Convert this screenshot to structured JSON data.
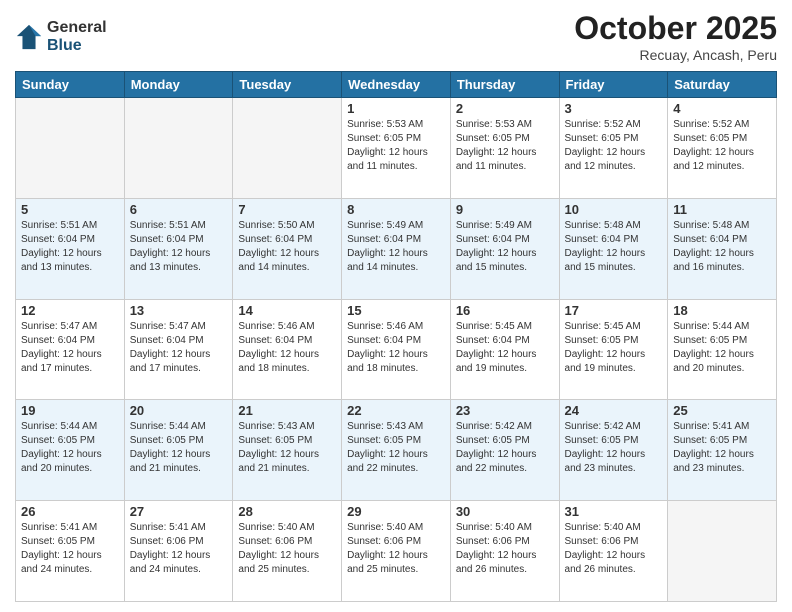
{
  "header": {
    "logo_general": "General",
    "logo_blue": "Blue",
    "month_title": "October 2025",
    "location": "Recuay, Ancash, Peru"
  },
  "weekdays": [
    "Sunday",
    "Monday",
    "Tuesday",
    "Wednesday",
    "Thursday",
    "Friday",
    "Saturday"
  ],
  "weeks": [
    [
      {
        "day": "",
        "info": ""
      },
      {
        "day": "",
        "info": ""
      },
      {
        "day": "",
        "info": ""
      },
      {
        "day": "1",
        "info": "Sunrise: 5:53 AM\nSunset: 6:05 PM\nDaylight: 12 hours\nand 11 minutes."
      },
      {
        "day": "2",
        "info": "Sunrise: 5:53 AM\nSunset: 6:05 PM\nDaylight: 12 hours\nand 11 minutes."
      },
      {
        "day": "3",
        "info": "Sunrise: 5:52 AM\nSunset: 6:05 PM\nDaylight: 12 hours\nand 12 minutes."
      },
      {
        "day": "4",
        "info": "Sunrise: 5:52 AM\nSunset: 6:05 PM\nDaylight: 12 hours\nand 12 minutes."
      }
    ],
    [
      {
        "day": "5",
        "info": "Sunrise: 5:51 AM\nSunset: 6:04 PM\nDaylight: 12 hours\nand 13 minutes."
      },
      {
        "day": "6",
        "info": "Sunrise: 5:51 AM\nSunset: 6:04 PM\nDaylight: 12 hours\nand 13 minutes."
      },
      {
        "day": "7",
        "info": "Sunrise: 5:50 AM\nSunset: 6:04 PM\nDaylight: 12 hours\nand 14 minutes."
      },
      {
        "day": "8",
        "info": "Sunrise: 5:49 AM\nSunset: 6:04 PM\nDaylight: 12 hours\nand 14 minutes."
      },
      {
        "day": "9",
        "info": "Sunrise: 5:49 AM\nSunset: 6:04 PM\nDaylight: 12 hours\nand 15 minutes."
      },
      {
        "day": "10",
        "info": "Sunrise: 5:48 AM\nSunset: 6:04 PM\nDaylight: 12 hours\nand 15 minutes."
      },
      {
        "day": "11",
        "info": "Sunrise: 5:48 AM\nSunset: 6:04 PM\nDaylight: 12 hours\nand 16 minutes."
      }
    ],
    [
      {
        "day": "12",
        "info": "Sunrise: 5:47 AM\nSunset: 6:04 PM\nDaylight: 12 hours\nand 17 minutes."
      },
      {
        "day": "13",
        "info": "Sunrise: 5:47 AM\nSunset: 6:04 PM\nDaylight: 12 hours\nand 17 minutes."
      },
      {
        "day": "14",
        "info": "Sunrise: 5:46 AM\nSunset: 6:04 PM\nDaylight: 12 hours\nand 18 minutes."
      },
      {
        "day": "15",
        "info": "Sunrise: 5:46 AM\nSunset: 6:04 PM\nDaylight: 12 hours\nand 18 minutes."
      },
      {
        "day": "16",
        "info": "Sunrise: 5:45 AM\nSunset: 6:04 PM\nDaylight: 12 hours\nand 19 minutes."
      },
      {
        "day": "17",
        "info": "Sunrise: 5:45 AM\nSunset: 6:05 PM\nDaylight: 12 hours\nand 19 minutes."
      },
      {
        "day": "18",
        "info": "Sunrise: 5:44 AM\nSunset: 6:05 PM\nDaylight: 12 hours\nand 20 minutes."
      }
    ],
    [
      {
        "day": "19",
        "info": "Sunrise: 5:44 AM\nSunset: 6:05 PM\nDaylight: 12 hours\nand 20 minutes."
      },
      {
        "day": "20",
        "info": "Sunrise: 5:44 AM\nSunset: 6:05 PM\nDaylight: 12 hours\nand 21 minutes."
      },
      {
        "day": "21",
        "info": "Sunrise: 5:43 AM\nSunset: 6:05 PM\nDaylight: 12 hours\nand 21 minutes."
      },
      {
        "day": "22",
        "info": "Sunrise: 5:43 AM\nSunset: 6:05 PM\nDaylight: 12 hours\nand 22 minutes."
      },
      {
        "day": "23",
        "info": "Sunrise: 5:42 AM\nSunset: 6:05 PM\nDaylight: 12 hours\nand 22 minutes."
      },
      {
        "day": "24",
        "info": "Sunrise: 5:42 AM\nSunset: 6:05 PM\nDaylight: 12 hours\nand 23 minutes."
      },
      {
        "day": "25",
        "info": "Sunrise: 5:41 AM\nSunset: 6:05 PM\nDaylight: 12 hours\nand 23 minutes."
      }
    ],
    [
      {
        "day": "26",
        "info": "Sunrise: 5:41 AM\nSunset: 6:05 PM\nDaylight: 12 hours\nand 24 minutes."
      },
      {
        "day": "27",
        "info": "Sunrise: 5:41 AM\nSunset: 6:06 PM\nDaylight: 12 hours\nand 24 minutes."
      },
      {
        "day": "28",
        "info": "Sunrise: 5:40 AM\nSunset: 6:06 PM\nDaylight: 12 hours\nand 25 minutes."
      },
      {
        "day": "29",
        "info": "Sunrise: 5:40 AM\nSunset: 6:06 PM\nDaylight: 12 hours\nand 25 minutes."
      },
      {
        "day": "30",
        "info": "Sunrise: 5:40 AM\nSunset: 6:06 PM\nDaylight: 12 hours\nand 26 minutes."
      },
      {
        "day": "31",
        "info": "Sunrise: 5:40 AM\nSunset: 6:06 PM\nDaylight: 12 hours\nand 26 minutes."
      },
      {
        "day": "",
        "info": ""
      }
    ]
  ]
}
